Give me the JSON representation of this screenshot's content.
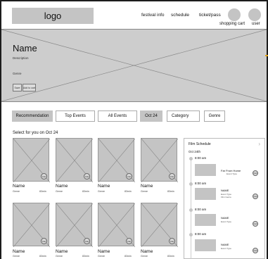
{
  "header": {
    "logo": "logo",
    "nav": [
      "festival info",
      "schedule",
      "ticket/pass"
    ],
    "shopping_cart_label": "shopping cart",
    "user_label": "user"
  },
  "hero": {
    "name": "Name",
    "description": "Description",
    "genre": "Genre",
    "buttons": [
      "Save",
      "Add to cart"
    ]
  },
  "filters": {
    "recommendation": "Recommendation",
    "top_events": "Top Events",
    "all_events": "All Events",
    "date": "Oct 24",
    "category": "Category",
    "genre": "Genre"
  },
  "section_label": "Select for you on Oct 24",
  "cards": [
    {
      "name": "Name",
      "genre": "Genre",
      "duration": "83min"
    },
    {
      "name": "Name",
      "genre": "Genre",
      "duration": "83min"
    },
    {
      "name": "Name",
      "genre": "Genre",
      "duration": "83min"
    },
    {
      "name": "Name",
      "genre": "Genre",
      "duration": "83min"
    },
    {
      "name": "Name",
      "genre": "Genre",
      "duration": "83min"
    },
    {
      "name": "Name",
      "genre": "Genre",
      "duration": "83min"
    },
    {
      "name": "Name",
      "genre": "Genre",
      "duration": "83min"
    },
    {
      "name": "Name",
      "genre": "Genre",
      "duration": "83min"
    }
  ],
  "cart_icon_label": "Cart",
  "schedule": {
    "title": "Film Schedule",
    "date": "Oct 24th",
    "items": [
      {
        "time": "8:00 am",
        "name": "Far From Home",
        "type": "Event Type",
        "extra": ""
      },
      {
        "time": "8:00 am",
        "name": "NAME",
        "type": "Event Type",
        "extra": "Film Genre"
      },
      {
        "time": "8:00 am",
        "name": "NAME",
        "type": "Event Type",
        "extra": ""
      },
      {
        "time": "8:00 am",
        "name": "NAME",
        "type": "Event Type",
        "extra": ""
      }
    ]
  },
  "colors": {
    "page_bg": "#1c1c1c",
    "placeholder": "#c4c4c4",
    "accent_edge": "#e0a21a"
  }
}
